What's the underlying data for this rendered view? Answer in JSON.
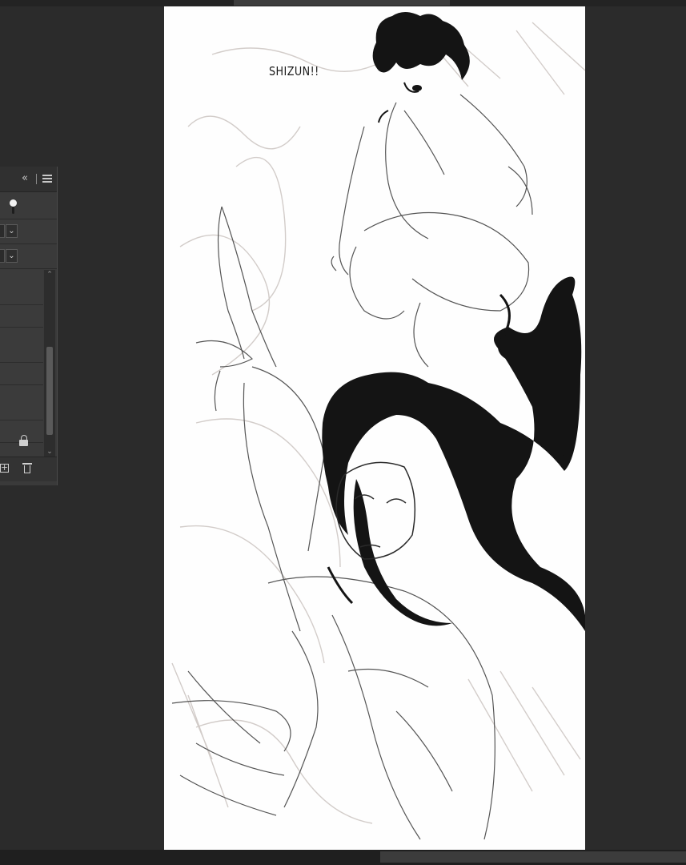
{
  "window": {
    "top_scrollbar": "horizontal-scrollbar",
    "bottom_scrollbar": "horizontal-scrollbar"
  },
  "layer_panel": {
    "header_icons": [
      "collapse-chevrons-icon",
      "panel-menu-icon"
    ],
    "dropdown_chevron": "⌄",
    "collapse_glyph": "«",
    "new_layer_glyph": "+",
    "scroll_up_glyph": "⌃",
    "scroll_down_glyph": "⌄"
  },
  "canvas": {
    "speech_text": "SHIZUN!!",
    "colors": {
      "ink": "#141414",
      "sketch": "#b9b2ae",
      "paper": "#fefefe"
    }
  }
}
